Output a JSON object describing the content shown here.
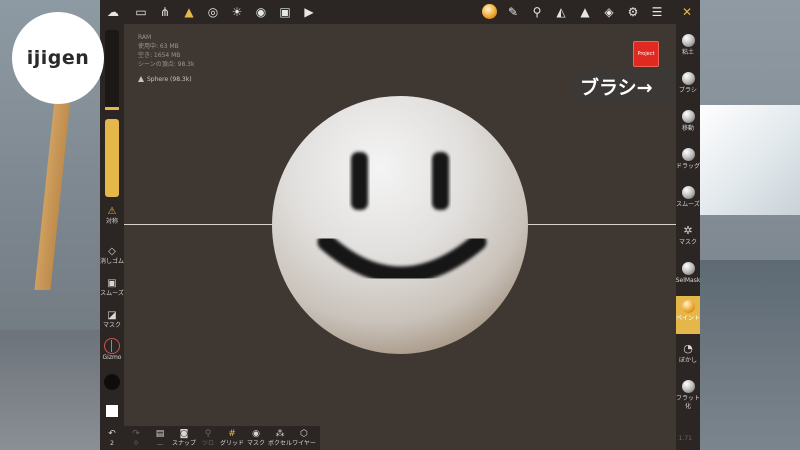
{
  "app": {
    "logo_text": "ijigen",
    "stats": {
      "ram_label": "RAM",
      "used": "使用中: 63 MB",
      "free": "空き: 1654 MB",
      "scene_vertices": "シーンの頂点: 98.3k"
    },
    "object": {
      "name": "Sphere (98.3k)"
    },
    "project_label": "Project",
    "callout": "ブラシ→",
    "version": "1.71"
  },
  "top_toolbar": {
    "items": [
      {
        "name": "app-icon",
        "glyph": "☁"
      },
      {
        "name": "folder-icon",
        "glyph": "▭"
      },
      {
        "name": "scene-graph-icon",
        "glyph": "⋔"
      },
      {
        "name": "mesh-icon",
        "glyph": "▲",
        "active": true
      },
      {
        "name": "globe-icon",
        "glyph": "◎"
      },
      {
        "name": "light-icon",
        "glyph": "☀"
      },
      {
        "name": "material-icon",
        "glyph": "◉"
      },
      {
        "name": "image-icon",
        "glyph": "▣"
      },
      {
        "name": "video-icon",
        "glyph": "▶"
      }
    ],
    "right_items": [
      {
        "name": "paint-brush-icon",
        "glyph": "✎"
      },
      {
        "name": "dropper-icon",
        "glyph": "⚲"
      },
      {
        "name": "symmetry-icon",
        "glyph": "◭"
      },
      {
        "name": "layers-icon",
        "glyph": "◈"
      },
      {
        "name": "settings-icon",
        "glyph": "⚙"
      },
      {
        "name": "sliders-icon",
        "glyph": "☰"
      },
      {
        "name": "tools-icon",
        "glyph": "✕"
      }
    ]
  },
  "left_toolbar": {
    "symmetry_label": "対称",
    "eraser_label": "消しゴム",
    "smooth_label": "スムーズ",
    "mask_label": "マスク",
    "gizmo_label": "Gizmo"
  },
  "right_toolbar": {
    "items": [
      {
        "label": "粘土"
      },
      {
        "label": "ブラシ"
      },
      {
        "label": "移動"
      },
      {
        "label": "ドラッグ"
      },
      {
        "label": "スムーズ"
      },
      {
        "label": "マスク"
      },
      {
        "label": "SelMask"
      },
      {
        "label": "ペイント",
        "active": true
      },
      {
        "label": "ぼかし"
      },
      {
        "label": "フラット化"
      }
    ]
  },
  "bottom_toolbar": {
    "undo_label": "2",
    "redo_label": "0",
    "items": [
      {
        "label": "…"
      },
      {
        "label": "スナップ"
      },
      {
        "label": "ツロ"
      },
      {
        "label": "グリッド"
      },
      {
        "label": "マスク"
      },
      {
        "label": "ボクセル"
      },
      {
        "label": "ワイヤー"
      }
    ]
  },
  "colors": {
    "accent": "#e5b64a",
    "toolbar": "#2b2624",
    "viewport": "#3f3732",
    "project_red": "#e02a21"
  }
}
